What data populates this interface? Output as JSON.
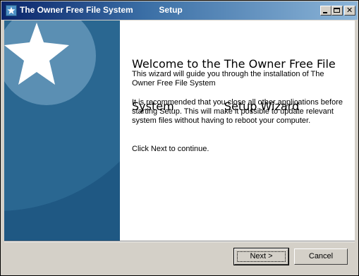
{
  "window": {
    "title": "The Owner Free File System           Setup",
    "icons": {
      "app": "star-icon",
      "minimize": "minimize-icon",
      "maximize": "maximize-icon",
      "close": "close-icon"
    }
  },
  "sidebar": {
    "logo_icon": "star-icon",
    "color": "#1f5883"
  },
  "main": {
    "heading_line1": "Welcome to the The Owner Free File",
    "heading_line2": "System              Setup Wizard",
    "paragraph1": "This wizard will guide you through the installation of The Owner Free File System",
    "paragraph2": "It is recommended that you close all other applications before starting Setup. This will make it possible to update relevant system files without having to reboot your computer.",
    "paragraph3": "Click Next to continue."
  },
  "buttons": {
    "next": "Next >",
    "cancel": "Cancel"
  }
}
